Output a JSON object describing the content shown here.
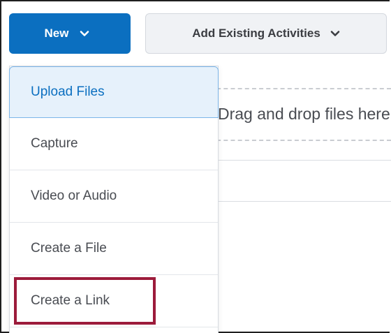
{
  "toolbar": {
    "new_label": "New",
    "add_existing_label": "Add Existing Activities",
    "new_icon": "chevron-down-icon",
    "add_icon": "chevron-down-icon"
  },
  "dropzone": {
    "text": "Drag and drop files here to"
  },
  "new_menu": {
    "items": [
      {
        "label": "Upload Files"
      },
      {
        "label": "Capture"
      },
      {
        "label": "Video or Audio"
      },
      {
        "label": "Create a File"
      },
      {
        "label": "Create a Link"
      }
    ]
  },
  "colors": {
    "primary": "#0b6fc0",
    "highlight_box": "#9c1b3b",
    "active_item_bg": "#e6f1fb"
  }
}
